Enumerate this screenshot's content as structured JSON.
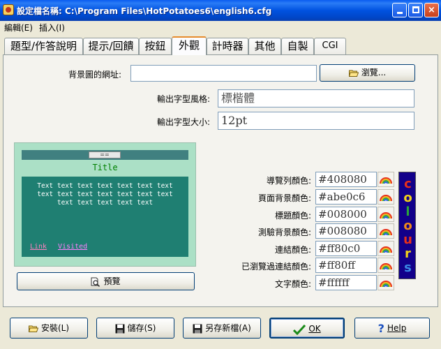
{
  "window": {
    "title": "設定檔名稱: C:\\Program Files\\HotPotatoes6\\english6.cfg",
    "controls": {
      "minimize": "",
      "maximize": "",
      "close": "×"
    }
  },
  "menu": [
    {
      "label": "編輯(E)"
    },
    {
      "label": "插入(I)"
    }
  ],
  "tabs": [
    {
      "label": "題型/作答說明",
      "active": false
    },
    {
      "label": "提示/回饋",
      "active": false
    },
    {
      "label": "按鈕",
      "active": false
    },
    {
      "label": "外觀",
      "active": true
    },
    {
      "label": "計時器",
      "active": false
    },
    {
      "label": "其他",
      "active": false
    },
    {
      "label": "自製",
      "active": false
    },
    {
      "label": "CGI",
      "active": false
    }
  ],
  "appearance": {
    "bg_image_label": "背景圖的網址:",
    "bg_image_value": "",
    "browse_button": "瀏覽...",
    "font_style_label": "輸出字型風格:",
    "font_style_value": "標楷體",
    "font_size_label": "輸出字型大小:",
    "font_size_value": "12pt"
  },
  "preview": {
    "nav_button": "==",
    "title": "Title",
    "body_lines": [
      "Text text text text text text text",
      "text text text text text text text",
      "text text text text text"
    ],
    "link": "Link",
    "visited": "Visited",
    "preview_button": "預覽",
    "colors": {
      "frame_bg": "#abe0c6",
      "nav": "#408080",
      "title": "#008000",
      "body_bg": "#1f7f72",
      "text": "#ffffff",
      "link": "#ff80c0",
      "visited": "#ff80ff"
    }
  },
  "colors": [
    {
      "label": "導覽列顏色:",
      "value": "#408080"
    },
    {
      "label": "頁面背景顏色:",
      "value": "#abe0c6"
    },
    {
      "label": "標題顏色:",
      "value": "#008000"
    },
    {
      "label": "測驗背景顏色:",
      "value": "#008080"
    },
    {
      "label": "連結顏色:",
      "value": "#ff80c0"
    },
    {
      "label": "已瀏覽過連結顏色:",
      "value": "#ff80ff"
    },
    {
      "label": "文字顏色:",
      "value": "#ffffff"
    }
  ],
  "colours_banner": "colours",
  "bottom_buttons": {
    "install": "安裝(L)",
    "save": "儲存(S)",
    "save_as": "另存新檔(A)",
    "ok": "OK",
    "help": "Help"
  }
}
